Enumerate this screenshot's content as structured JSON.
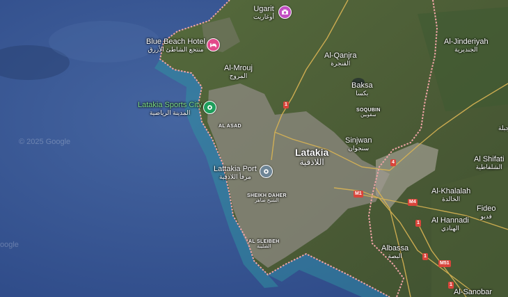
{
  "watermark": "© 2025 Google",
  "watermark_edge": "oogle",
  "colors": {
    "sea": "#3b5a93",
    "sea_deep": "#2d4a85",
    "coast": "#2f8fa0",
    "land": "#4e5e3a",
    "city": "#8e8a82",
    "border": "#f0a4a6"
  },
  "places": {
    "ugarit": {
      "en": "Ugarit",
      "ar": "أوغاريت"
    },
    "blue_beach": {
      "en": "Blue Beach Hotel",
      "ar": "منتجع الشاطئ الأزرق"
    },
    "almrouj": {
      "en": "Al-Mrouj",
      "ar": "المروج"
    },
    "alqanjra": {
      "en": "Al-Qanjra",
      "ar": "القنجرة"
    },
    "baksa": {
      "en": "Baksa",
      "ar": "بكسا"
    },
    "aljinderiyah": {
      "en": "Al-Jinderiyah",
      "ar": "الجنديرية"
    },
    "sports_city": {
      "en": "Latakia Sports City",
      "ar": "المدينة الرياضية"
    },
    "alasad": {
      "en": "AL ASAD",
      "ar": ""
    },
    "soqubin": {
      "en": "SOQUBIN",
      "ar": "سقوبين"
    },
    "sinjwan": {
      "en": "Sinjwan",
      "ar": "سنجوان"
    },
    "latakia": {
      "en": "Latakia",
      "ar": "اللاذقية"
    },
    "port": {
      "en": "Lattakia Port",
      "ar": "مرفأ اللاذقية"
    },
    "sheikh_daher": {
      "en": "SHEIKH DAHER",
      "ar": "الشيخ ضاهر"
    },
    "al_shifati": {
      "en": "Al Shifati",
      "ar": "الشلفاطية"
    },
    "al_khalalah": {
      "en": "Al-Khalalah",
      "ar": "الخالدة"
    },
    "al_hannadi": {
      "en": "Al Hannadi",
      "ar": "الهنادي"
    },
    "fideo": {
      "en": "Fideo",
      "ar": "فديو"
    },
    "alsleibeh": {
      "en": "AL SLEIBEH",
      "ar": "الصليبة"
    },
    "albassa": {
      "en": "Albassa",
      "ar": "البصة"
    },
    "al_sanobar": {
      "en": "Al-Sanobar",
      "ar": ""
    },
    "east_edge_ar": {
      "ar": "جبلة"
    }
  },
  "roads": {
    "r1a": "1",
    "r1b": "1",
    "r4a": "4",
    "m1": "M1",
    "m4": "M4",
    "r1c": "1",
    "m51": "M51",
    "r1d": "1"
  }
}
